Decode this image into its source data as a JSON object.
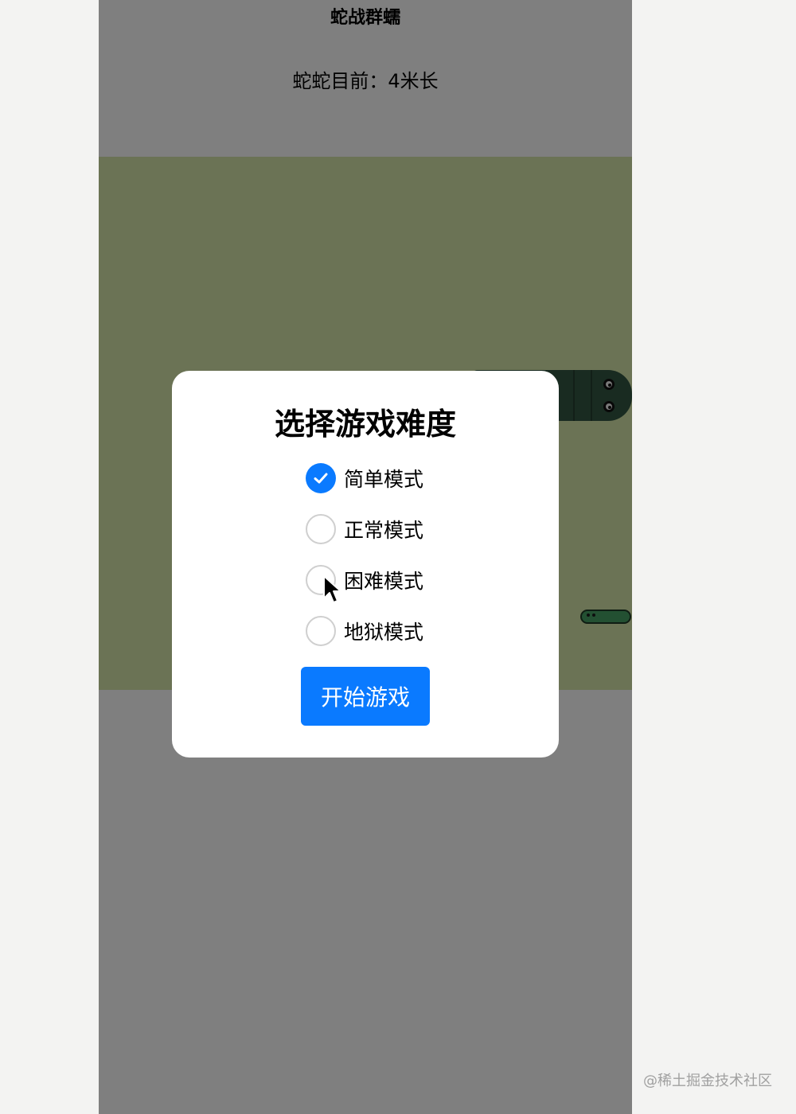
{
  "game": {
    "title": "蛇战群蠕",
    "length_text": "蛇蛇目前：4米长"
  },
  "dialog": {
    "title": "选择游戏难度",
    "options": [
      {
        "label": "简单模式",
        "selected": true
      },
      {
        "label": "正常模式",
        "selected": false
      },
      {
        "label": "困难模式",
        "selected": false
      },
      {
        "label": "地狱模式",
        "selected": false
      }
    ],
    "start_button": "开始游戏"
  },
  "watermark": "@稀土掘金技术社区",
  "colors": {
    "accent": "#0a7aff",
    "board": "#d7e6ab",
    "snake": "#335742",
    "worm": "#46a064"
  }
}
